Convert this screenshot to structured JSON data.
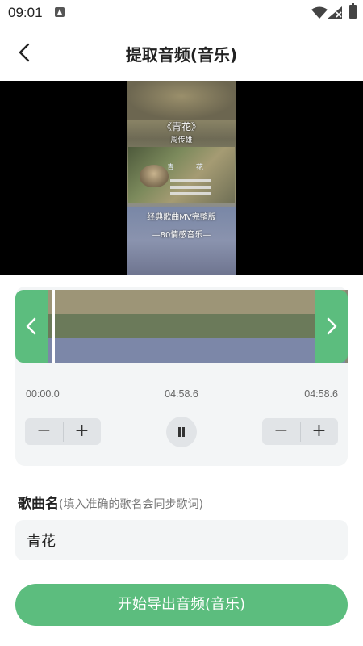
{
  "status_bar": {
    "time": "09:01",
    "icons": [
      "notification-icon",
      "wifi-icon",
      "signal-icon",
      "battery-icon"
    ]
  },
  "header": {
    "back_icon": "chevron-left-icon",
    "title": "提取音频(音乐)"
  },
  "video": {
    "title": "《青花》",
    "artist": "周传雄",
    "inner_title": "青 花",
    "promo_line1": "经典歌曲MV完整版",
    "promo_line2": "—80情感音乐—"
  },
  "trimmer": {
    "left_handle_icon": "chevron-left-icon",
    "right_handle_icon": "chevron-right-icon",
    "start_time": "00:00.0",
    "current_time": "04:58.6",
    "end_time": "04:58.6",
    "minus_label": "−",
    "plus_label": "+",
    "pause_icon": "pause-icon"
  },
  "song": {
    "label": "歌曲名",
    "hint": "(填入准确的歌名会同步歌词)",
    "value": "青花"
  },
  "export_button": {
    "label": "开始导出音频(音乐)"
  },
  "colors": {
    "accent": "#5cbd7e",
    "card_background": "#f3f5f6",
    "control_background": "#e1e4e7"
  }
}
